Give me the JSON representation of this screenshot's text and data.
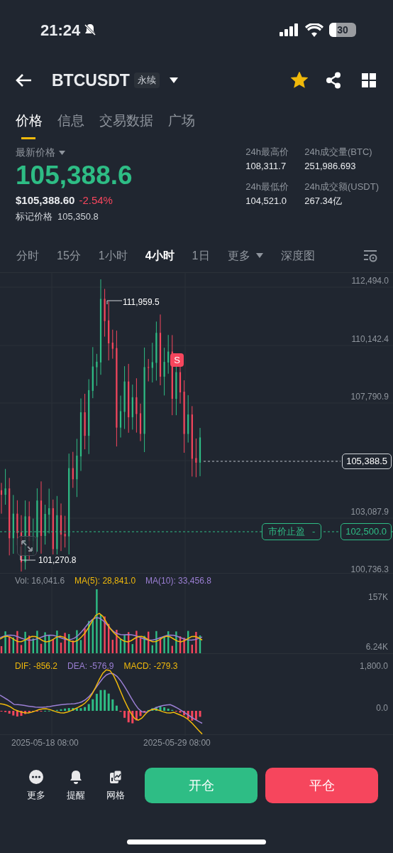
{
  "status_bar": {
    "time": "21:24",
    "battery": "30"
  },
  "header": {
    "symbol": "BTCUSDT",
    "badge": "永续",
    "favorite": true
  },
  "tabs": [
    {
      "label": "价格",
      "selected": true
    },
    {
      "label": "信息",
      "selected": false
    },
    {
      "label": "交易数据",
      "selected": false
    },
    {
      "label": "广场",
      "selected": false
    }
  ],
  "price": {
    "label": "最新价格",
    "last": "105,388.6",
    "usd": "$105,388.60",
    "change": "-2.54%",
    "mark_label": "标记价格",
    "mark_value": "105,350.8"
  },
  "stats": [
    {
      "label": "24h最高价",
      "value": "108,311.7"
    },
    {
      "label": "24h成交量(BTC)",
      "value": "251,986.693"
    },
    {
      "label": "24h最低价",
      "value": "104,521.0"
    },
    {
      "label": "24h成交额(USDT)",
      "value": "267.34亿"
    }
  ],
  "intervals": [
    {
      "label": "分时",
      "selected": false,
      "kind": "option"
    },
    {
      "label": "15分",
      "selected": false,
      "kind": "option"
    },
    {
      "label": "1小时",
      "selected": false,
      "kind": "option"
    },
    {
      "label": "4小时",
      "selected": true,
      "kind": "option"
    },
    {
      "label": "1日",
      "selected": false,
      "kind": "option"
    },
    {
      "label": "更多",
      "selected": false,
      "kind": "dropdown"
    },
    {
      "label": "深度图",
      "selected": false,
      "kind": "option"
    }
  ],
  "chart": {
    "y_ticks": [
      "112,494.0",
      "110,142.4",
      "107,790.9",
      "103,087.9",
      "100,736.3"
    ],
    "high_label": "111,959.5",
    "low_label": "101,270.8",
    "last_price": "105,388.5",
    "signal": "S",
    "take_profit": {
      "label": "市价止盈",
      "action": "-",
      "price": "102,500.0"
    }
  },
  "volume": {
    "vol": "Vol: 16,041.6",
    "ma5": "MA(5): 28,841.0",
    "ma10": "MA(10): 33,456.8",
    "ticks": [
      "157K",
      "6.24K"
    ]
  },
  "macd": {
    "dif": "DIF: -856.2",
    "dea": "DEA: -576.9",
    "macd": "MACD: -279.3",
    "ticks": [
      "1,800.0",
      "0.0"
    ]
  },
  "dates": [
    "2025-05-18 08:00",
    "2025-05-29 08:00"
  ],
  "bottom": {
    "actions": [
      {
        "label": "更多",
        "kind": "more"
      },
      {
        "label": "提醒",
        "kind": "alert"
      },
      {
        "label": "网格",
        "kind": "grid"
      }
    ],
    "buttons": [
      {
        "label": "开仓",
        "kind": "open"
      },
      {
        "label": "平仓",
        "kind": "close"
      }
    ]
  }
}
